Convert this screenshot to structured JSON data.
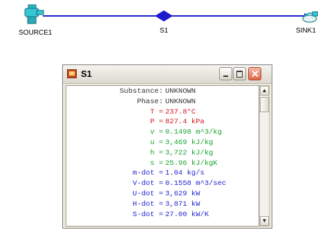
{
  "diagram": {
    "source_label": "SOURCE1",
    "stream_label": "S1",
    "sink_label": "SINK1",
    "line_color": "#1c1ccc",
    "source_icon": "faucet-icon",
    "sink_icon": "drain-icon"
  },
  "window": {
    "title": "S1",
    "min_icon": "minimize-icon",
    "max_icon": "maximize-icon",
    "close_icon": "close-icon"
  },
  "properties": [
    {
      "label": "Substance:",
      "value": "UNKNOWN",
      "color": "#333333"
    },
    {
      "label": "Phase:",
      "value": "UNKNOWN",
      "color": "#333333"
    },
    {
      "label": "T =",
      "value": "237.8°C",
      "color": "#d8141e"
    },
    {
      "label": "P =",
      "value": "827.4 kPa",
      "color": "#d8141e"
    },
    {
      "label": "v =",
      "value": "0.1498 m^3/kg",
      "color": "#17a62e"
    },
    {
      "label": "u =",
      "value": "3,469 kJ/kg",
      "color": "#17a62e"
    },
    {
      "label": "h =",
      "value": "3,722 kJ/kg",
      "color": "#17a62e"
    },
    {
      "label": "s =",
      "value": "25.96 kJ/kgK",
      "color": "#17a62e"
    },
    {
      "label": "m-dot =",
      "value": "1.04 kg/s",
      "color": "#2323d0"
    },
    {
      "label": "V-dot =",
      "value": "0.1558 m^3/sec",
      "color": "#2323d0"
    },
    {
      "label": "U-dot =",
      "value": "3,629 kW",
      "color": "#2323d0"
    },
    {
      "label": "H-dot =",
      "value": "3,871 kW",
      "color": "#2323d0"
    },
    {
      "label": "S-dot =",
      "value": "27.00 kW/K",
      "color": "#2323d0"
    }
  ]
}
